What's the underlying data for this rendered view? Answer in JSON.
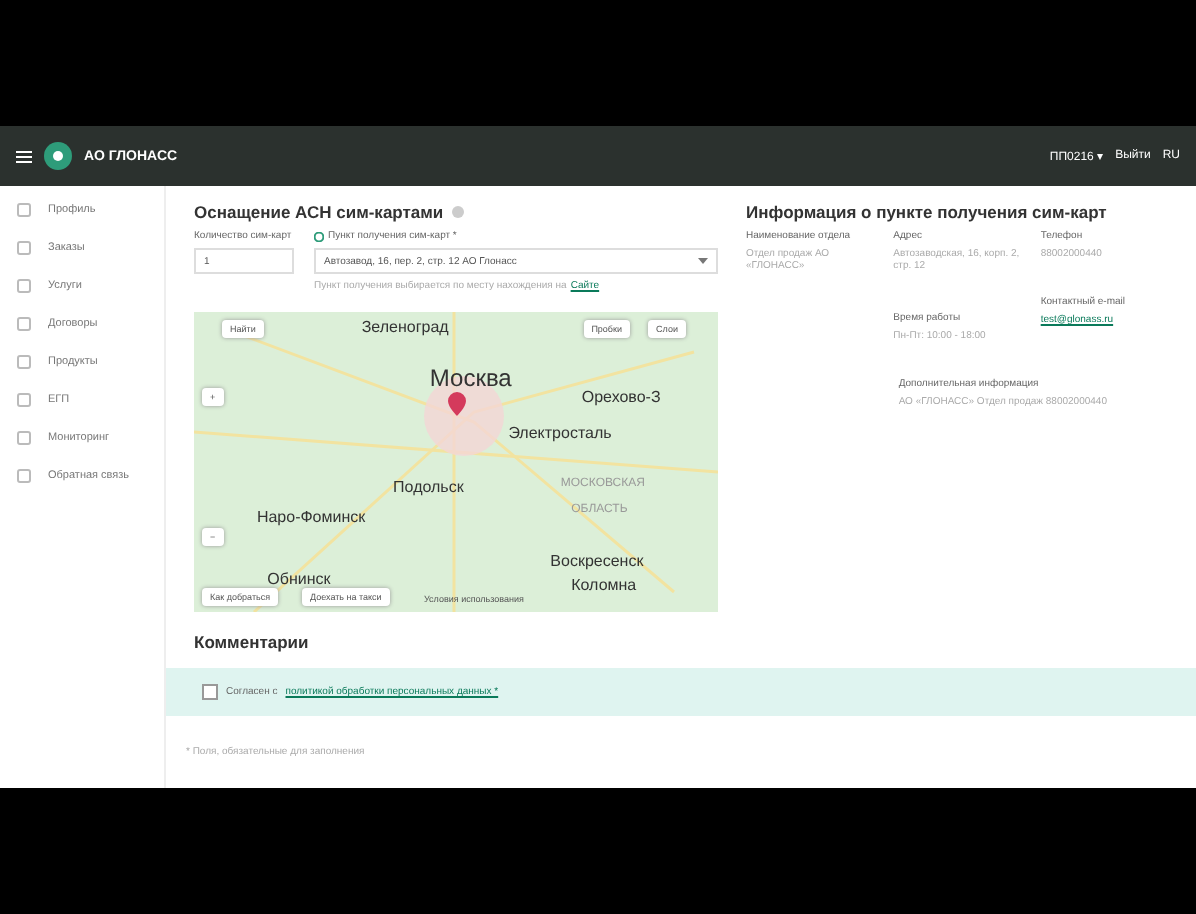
{
  "header": {
    "brand": "АО ГЛОНАСС",
    "user": "ПП0216 ▾",
    "logout": "Выйти",
    "lang": "RU"
  },
  "sidebar": {
    "items": [
      {
        "label": "Профиль",
        "selected": false
      },
      {
        "label": "Заказы",
        "selected": false
      },
      {
        "label": "Услуги",
        "selected": false
      },
      {
        "label": "Договоры",
        "selected": false
      },
      {
        "label": "Продукты",
        "selected": false
      },
      {
        "label": "ЕГП",
        "selected": false
      },
      {
        "label": "Мониторинг",
        "selected": false
      },
      {
        "label": "Обратная связь",
        "selected": false
      }
    ]
  },
  "form": {
    "title": "Оснащение АСН сим-картами",
    "quantity_label": "Количество сим-карт",
    "quantity_value": "1",
    "pickup_label": "Пункт получения сим-карт *",
    "pickup_value": "Автозавод, 16, пер. 2, стр. 12 АО Глонасс",
    "hint": "Пункт получения выбирается по месту нахождения на",
    "hint_link": "Сайте",
    "map": {
      "search": "Найти",
      "zoom_in": "+",
      "zoom_out": "−",
      "traffic": "Пробки",
      "layers": "Слои",
      "route": "Как добраться",
      "taxi": "Доехать на такси",
      "terms": "Условия использования",
      "places": [
        "Зеленоград",
        "Москва",
        "Орехово-З",
        "Электросталь",
        "МОСКОВСКАЯ",
        "ОБЛАСТЬ",
        "Подольск",
        "Наро-Фоминск",
        "Воскресенск",
        "Обнинск",
        "Коломна"
      ]
    },
    "comments_title": "Комментарии",
    "consent": {
      "text": "Согласен с",
      "link": "политикой обработки персональных данных *",
      "checked": false
    },
    "required_note": "* Поля, обязательные для заполнения"
  },
  "info": {
    "title": "Информация о пункте получения сим-карт",
    "columns": [
      {
        "label": "Наименование отдела",
        "value": "Отдел продаж АО «ГЛОНАСС»"
      },
      {
        "label": "Адрес",
        "value": "Автозаводская, 16, корп. 2, стр. 12"
      },
      {
        "label": "Телефон",
        "value": "88002000440"
      }
    ],
    "hours_label": "Время работы",
    "hours": "Пн-Пт: 10:00 - 18:00",
    "email_label": "Контактный e-mail",
    "email": "test@glonass.ru",
    "extra_label": "Дополнительная информация",
    "extra": "АО «ГЛОНАСС» Отдел продаж 88002000440"
  }
}
